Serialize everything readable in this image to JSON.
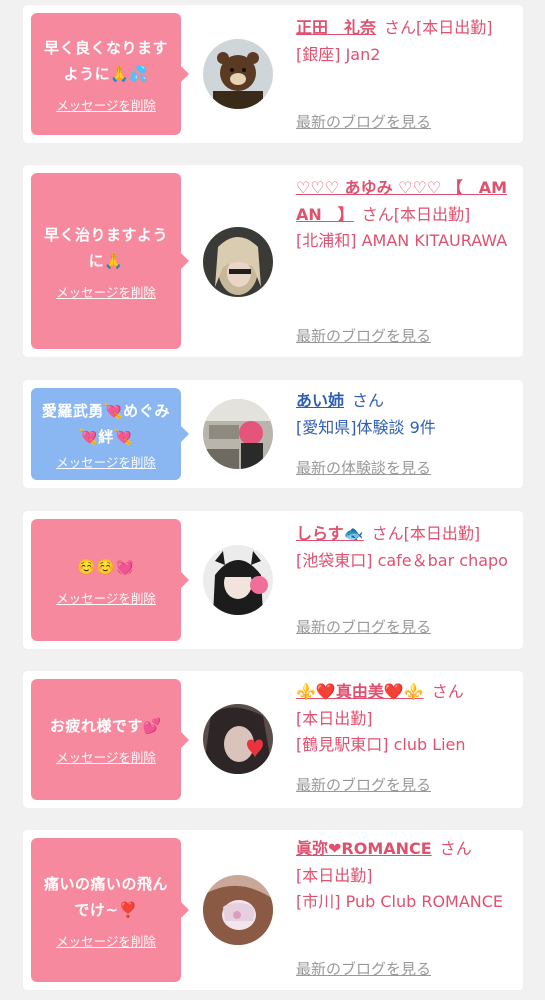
{
  "cards": [
    {
      "message": "早く良くなりますように🙏💦",
      "delete_label": "メッセージを削除",
      "name": "正田　礼奈",
      "san": "さん",
      "status": "[本日出勤]",
      "detail": "[銀座] Jan2",
      "link": "最新のブログを見る",
      "bubble_color": "#f6899e"
    },
    {
      "message": "早く治りますように🙏",
      "delete_label": "メッセージを削除",
      "name": "♡♡♡ あゆみ ♡♡♡ 【　AMAN　】",
      "san": "さん",
      "status": "[本日出勤]",
      "detail": "[北浦和] AMAN KITAURAWA",
      "link": "最新のブログを見る",
      "bubble_color": "#f6899e"
    },
    {
      "message": "愛羅武勇💘めぐみ💘絆💘",
      "delete_label": "メッセージを削除",
      "name": "あい姉",
      "san": "さん",
      "detail": "[愛知県]体験談 9件",
      "link": "最新の体験談を見る",
      "bubble_color": "#8ab6f2"
    },
    {
      "message": "☺️☺️💓",
      "delete_label": "メッセージを削除",
      "name": "しらす🐟",
      "san": "さん",
      "status": "[本日出勤]",
      "detail": "[池袋東口] cafe＆bar chapo",
      "link": "最新のブログを見る",
      "bubble_color": "#f6899e"
    },
    {
      "message": "お疲れ様です💕",
      "delete_label": "メッセージを削除",
      "name": "⚜️❤️真由美❤️⚜️",
      "san": "さん",
      "status": "[本日出勤]",
      "detail": "[鶴見駅東口] club Lien",
      "link": "最新のブログを見る",
      "bubble_color": "#f6899e"
    },
    {
      "message": "痛いの痛いの飛んでけ~❣️",
      "delete_label": "メッセージを削除",
      "name": "眞弥❤ROMANCE",
      "san": "さん",
      "status": "[本日出勤]",
      "detail": "[市川] Pub Club ROMANCE",
      "link": "最新のブログを見る",
      "bubble_color": "#f6899e"
    }
  ]
}
